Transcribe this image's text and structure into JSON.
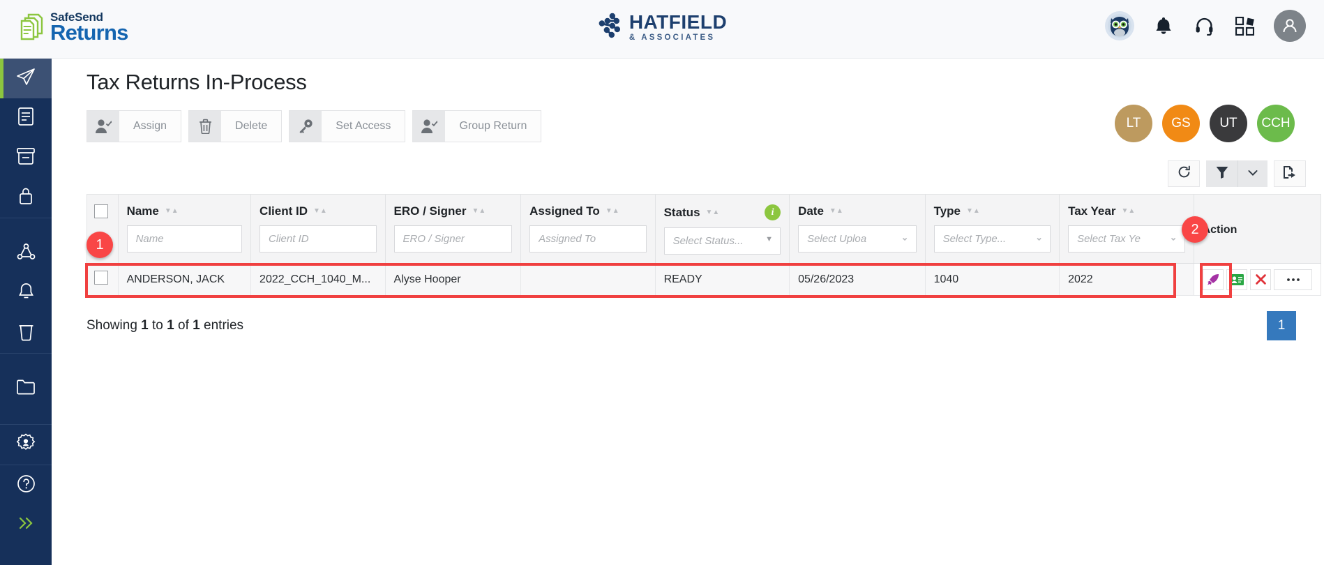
{
  "header": {
    "brand_line1": "SafeSend",
    "brand_line2": "Returns",
    "brand_icon": "documents-icon",
    "client_logo_line1": "HATFIELD",
    "client_logo_line2": "& ASSOCIATES",
    "client_logo_icon": "hatfield-network-icon",
    "icons": [
      {
        "name": "owl-mascot-avatar",
        "label": "Owl"
      },
      {
        "name": "bell-icon",
        "label": "Notifications"
      },
      {
        "name": "headset-icon",
        "label": "Support"
      },
      {
        "name": "apps-grid-icon",
        "label": "Apps"
      },
      {
        "name": "user-avatar-icon",
        "label": "Account"
      }
    ]
  },
  "sidebar": {
    "items": [
      {
        "name": "sidebar-item-send",
        "icon": "paper-plane-icon",
        "active": true
      },
      {
        "name": "sidebar-item-documents",
        "icon": "document-lines-icon",
        "active": false
      },
      {
        "name": "sidebar-item-archive",
        "icon": "archive-box-icon",
        "active": false
      },
      {
        "name": "sidebar-item-locked",
        "icon": "padlock-icon",
        "active": false
      },
      {
        "name": "sidebar-item-share",
        "icon": "share-nodes-icon",
        "active": false
      },
      {
        "name": "sidebar-item-alerts",
        "icon": "bell-outline-icon",
        "active": false
      },
      {
        "name": "sidebar-item-recycle",
        "icon": "trash-bin-icon",
        "active": false
      },
      {
        "name": "sidebar-item-folder",
        "icon": "folder-icon",
        "active": false
      },
      {
        "name": "sidebar-item-settings",
        "icon": "gear-user-icon",
        "active": false
      },
      {
        "name": "sidebar-item-help",
        "icon": "question-circle-icon",
        "active": false
      },
      {
        "name": "sidebar-item-expand",
        "icon": "double-chevron-right-icon",
        "active": false
      }
    ]
  },
  "page": {
    "title": "Tax Returns In-Process"
  },
  "toolbar": {
    "buttons": [
      {
        "label": "Assign",
        "icon": "user-check-icon",
        "name": "assign-button"
      },
      {
        "label": "Delete",
        "icon": "trash-icon",
        "name": "delete-button"
      },
      {
        "label": "Set Access",
        "icon": "key-icon",
        "name": "set-access-button"
      },
      {
        "label": "Group Return",
        "icon": "user-check-icon",
        "name": "group-return-button"
      }
    ],
    "avatars": [
      {
        "initials": "LT",
        "color": "#bd9a5f"
      },
      {
        "initials": "GS",
        "color": "#f18a15"
      },
      {
        "initials": "UT",
        "color": "#3a3a3c"
      },
      {
        "initials": "CCH",
        "color": "#6cbb4b"
      }
    ]
  },
  "table_tools": [
    {
      "name": "refresh-button",
      "icon": "refresh-icon"
    },
    {
      "name": "filter-button",
      "icon": "funnel-icon"
    },
    {
      "name": "filter-dropdown-button",
      "icon": "chevron-down-icon"
    },
    {
      "name": "export-button",
      "icon": "export-document-icon"
    }
  ],
  "table": {
    "columns": [
      {
        "key": "name",
        "label": "Name",
        "placeholder": "Name",
        "control": "text"
      },
      {
        "key": "client_id",
        "label": "Client ID",
        "placeholder": "Client ID",
        "control": "text"
      },
      {
        "key": "ero_signer",
        "label": "ERO / Signer",
        "placeholder": "ERO / Signer",
        "control": "text"
      },
      {
        "key": "assigned_to",
        "label": "Assigned To",
        "placeholder": "Assigned To",
        "control": "text"
      },
      {
        "key": "status",
        "label": "Status",
        "placeholder": "Select Status...",
        "control": "select-solid",
        "info": true
      },
      {
        "key": "date",
        "label": "Date",
        "placeholder": "Select Uploa",
        "control": "select"
      },
      {
        "key": "type",
        "label": "Type",
        "placeholder": "Select Type...",
        "control": "select"
      },
      {
        "key": "tax_year",
        "label": "Tax Year",
        "placeholder": "Select Tax Ye",
        "control": "select"
      }
    ],
    "action_column_label": "Action",
    "rows": [
      {
        "name": "ANDERSON, JACK",
        "client_id": "2022_CCH_1040_M...",
        "ero_signer": "Alyse Hooper",
        "assigned_to": "",
        "status": "READY",
        "date": "05/26/2023",
        "type": "1040",
        "tax_year": "2022",
        "actions": [
          {
            "name": "send-rocket-action",
            "icon": "rocket-icon",
            "color": "#a432a4"
          },
          {
            "name": "client-view-action",
            "icon": "id-card-icon",
            "color": "#2aa744"
          },
          {
            "name": "delete-action",
            "icon": "red-x-icon",
            "color": "#e0333a"
          },
          {
            "name": "more-actions",
            "icon": "ellipsis-icon",
            "color": "#2b2f33"
          }
        ]
      }
    ]
  },
  "footer": {
    "showing_prefix": "Showing",
    "from": "1",
    "mid": "to",
    "to": "1",
    "of": "of",
    "total": "1",
    "suffix": "entries",
    "page_number": "1"
  },
  "annotations": [
    {
      "label": "1",
      "name": "annotation-badge-1"
    },
    {
      "label": "2",
      "name": "annotation-badge-2"
    }
  ],
  "colors": {
    "sidebar_bg": "#16305a",
    "accent_green": "#8cc63f",
    "highlight_red": "#f04040",
    "page_blue": "#3579bd"
  }
}
